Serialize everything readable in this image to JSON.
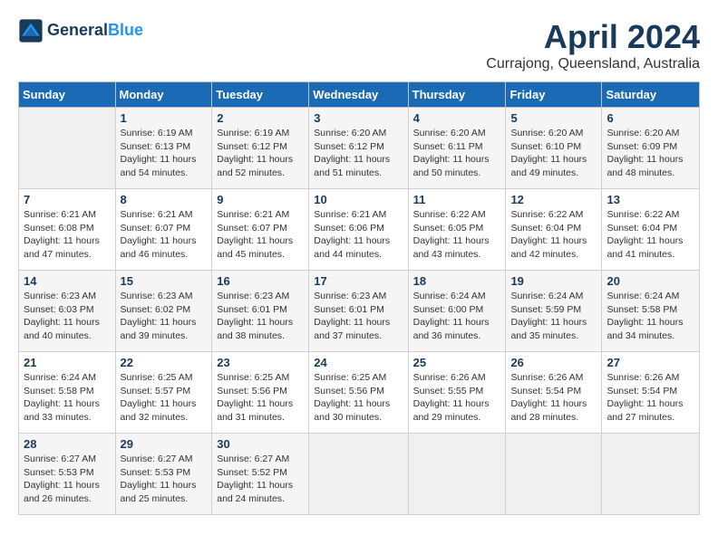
{
  "header": {
    "logo_line1": "General",
    "logo_line2": "Blue",
    "month_title": "April 2024",
    "subtitle": "Currajong, Queensland, Australia"
  },
  "weekdays": [
    "Sunday",
    "Monday",
    "Tuesday",
    "Wednesday",
    "Thursday",
    "Friday",
    "Saturday"
  ],
  "weeks": [
    [
      {
        "day": "",
        "info": ""
      },
      {
        "day": "1",
        "info": "Sunrise: 6:19 AM\nSunset: 6:13 PM\nDaylight: 11 hours\nand 54 minutes."
      },
      {
        "day": "2",
        "info": "Sunrise: 6:19 AM\nSunset: 6:12 PM\nDaylight: 11 hours\nand 52 minutes."
      },
      {
        "day": "3",
        "info": "Sunrise: 6:20 AM\nSunset: 6:12 PM\nDaylight: 11 hours\nand 51 minutes."
      },
      {
        "day": "4",
        "info": "Sunrise: 6:20 AM\nSunset: 6:11 PM\nDaylight: 11 hours\nand 50 minutes."
      },
      {
        "day": "5",
        "info": "Sunrise: 6:20 AM\nSunset: 6:10 PM\nDaylight: 11 hours\nand 49 minutes."
      },
      {
        "day": "6",
        "info": "Sunrise: 6:20 AM\nSunset: 6:09 PM\nDaylight: 11 hours\nand 48 minutes."
      }
    ],
    [
      {
        "day": "7",
        "info": "Sunrise: 6:21 AM\nSunset: 6:08 PM\nDaylight: 11 hours\nand 47 minutes."
      },
      {
        "day": "8",
        "info": "Sunrise: 6:21 AM\nSunset: 6:07 PM\nDaylight: 11 hours\nand 46 minutes."
      },
      {
        "day": "9",
        "info": "Sunrise: 6:21 AM\nSunset: 6:07 PM\nDaylight: 11 hours\nand 45 minutes."
      },
      {
        "day": "10",
        "info": "Sunrise: 6:21 AM\nSunset: 6:06 PM\nDaylight: 11 hours\nand 44 minutes."
      },
      {
        "day": "11",
        "info": "Sunrise: 6:22 AM\nSunset: 6:05 PM\nDaylight: 11 hours\nand 43 minutes."
      },
      {
        "day": "12",
        "info": "Sunrise: 6:22 AM\nSunset: 6:04 PM\nDaylight: 11 hours\nand 42 minutes."
      },
      {
        "day": "13",
        "info": "Sunrise: 6:22 AM\nSunset: 6:04 PM\nDaylight: 11 hours\nand 41 minutes."
      }
    ],
    [
      {
        "day": "14",
        "info": "Sunrise: 6:23 AM\nSunset: 6:03 PM\nDaylight: 11 hours\nand 40 minutes."
      },
      {
        "day": "15",
        "info": "Sunrise: 6:23 AM\nSunset: 6:02 PM\nDaylight: 11 hours\nand 39 minutes."
      },
      {
        "day": "16",
        "info": "Sunrise: 6:23 AM\nSunset: 6:01 PM\nDaylight: 11 hours\nand 38 minutes."
      },
      {
        "day": "17",
        "info": "Sunrise: 6:23 AM\nSunset: 6:01 PM\nDaylight: 11 hours\nand 37 minutes."
      },
      {
        "day": "18",
        "info": "Sunrise: 6:24 AM\nSunset: 6:00 PM\nDaylight: 11 hours\nand 36 minutes."
      },
      {
        "day": "19",
        "info": "Sunrise: 6:24 AM\nSunset: 5:59 PM\nDaylight: 11 hours\nand 35 minutes."
      },
      {
        "day": "20",
        "info": "Sunrise: 6:24 AM\nSunset: 5:58 PM\nDaylight: 11 hours\nand 34 minutes."
      }
    ],
    [
      {
        "day": "21",
        "info": "Sunrise: 6:24 AM\nSunset: 5:58 PM\nDaylight: 11 hours\nand 33 minutes."
      },
      {
        "day": "22",
        "info": "Sunrise: 6:25 AM\nSunset: 5:57 PM\nDaylight: 11 hours\nand 32 minutes."
      },
      {
        "day": "23",
        "info": "Sunrise: 6:25 AM\nSunset: 5:56 PM\nDaylight: 11 hours\nand 31 minutes."
      },
      {
        "day": "24",
        "info": "Sunrise: 6:25 AM\nSunset: 5:56 PM\nDaylight: 11 hours\nand 30 minutes."
      },
      {
        "day": "25",
        "info": "Sunrise: 6:26 AM\nSunset: 5:55 PM\nDaylight: 11 hours\nand 29 minutes."
      },
      {
        "day": "26",
        "info": "Sunrise: 6:26 AM\nSunset: 5:54 PM\nDaylight: 11 hours\nand 28 minutes."
      },
      {
        "day": "27",
        "info": "Sunrise: 6:26 AM\nSunset: 5:54 PM\nDaylight: 11 hours\nand 27 minutes."
      }
    ],
    [
      {
        "day": "28",
        "info": "Sunrise: 6:27 AM\nSunset: 5:53 PM\nDaylight: 11 hours\nand 26 minutes."
      },
      {
        "day": "29",
        "info": "Sunrise: 6:27 AM\nSunset: 5:53 PM\nDaylight: 11 hours\nand 25 minutes."
      },
      {
        "day": "30",
        "info": "Sunrise: 6:27 AM\nSunset: 5:52 PM\nDaylight: 11 hours\nand 24 minutes."
      },
      {
        "day": "",
        "info": ""
      },
      {
        "day": "",
        "info": ""
      },
      {
        "day": "",
        "info": ""
      },
      {
        "day": "",
        "info": ""
      }
    ]
  ]
}
